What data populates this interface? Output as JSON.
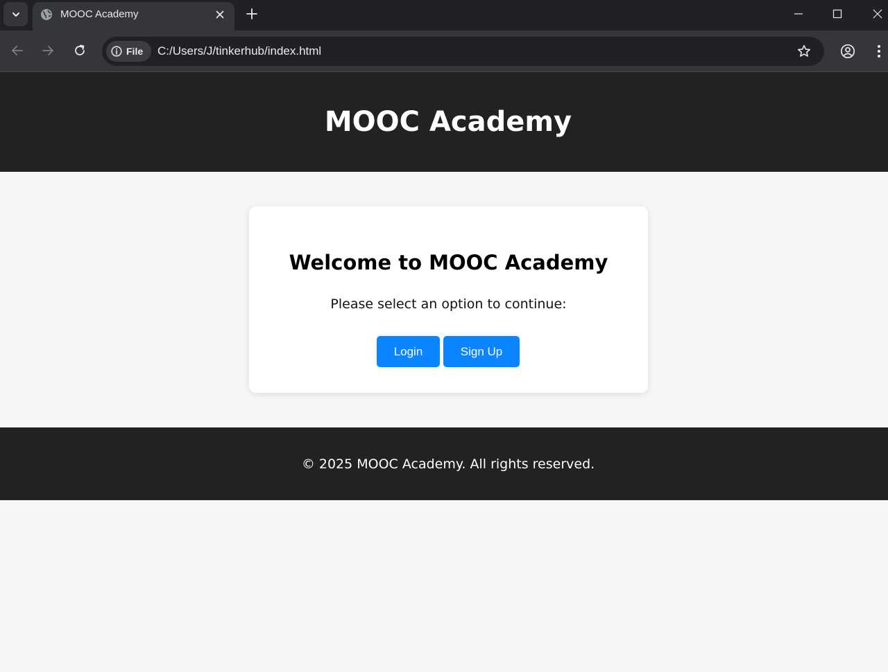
{
  "browser": {
    "tab": {
      "title": "MOOC Academy"
    },
    "address_bar": {
      "chip_label": "File",
      "url": "C:/Users/J/tinkerhub/index.html"
    },
    "icons": [
      "tab-search-icon",
      "globe-icon",
      "close-icon",
      "plus-icon",
      "minimize-icon",
      "maximize-icon",
      "window-close-icon",
      "back-arrow-icon",
      "forward-arrow-icon",
      "reload-icon",
      "info-icon",
      "star-icon",
      "profile-icon",
      "kebab-menu-icon"
    ]
  },
  "page": {
    "header": {
      "title": "MOOC Academy"
    },
    "card": {
      "heading": "Welcome to MOOC Academy",
      "prompt": "Please select an option to continue:",
      "login_label": "Login",
      "signup_label": "Sign Up"
    },
    "footer": {
      "text": "© 2025 MOOC Academy. All rights reserved."
    }
  },
  "colors": {
    "chrome_dark": "#202124",
    "chrome_toolbar": "#35363a",
    "header_bg": "#222222",
    "page_bg": "#f6f6f6",
    "button_blue": "#0a84ff"
  }
}
